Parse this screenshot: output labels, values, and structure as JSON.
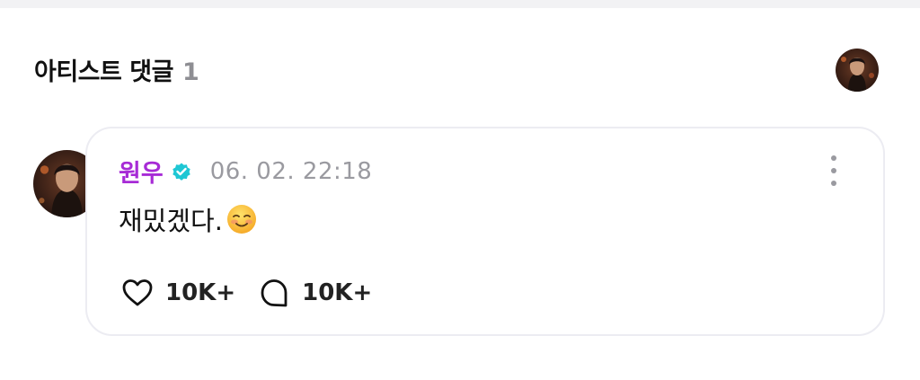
{
  "section": {
    "title": "아티스트 댓글",
    "count": "1"
  },
  "comment": {
    "author": "원우",
    "verified": true,
    "timestamp": "06. 02. 22:18",
    "text": "재밌겠다.",
    "emoji_icon": "smiling-face-icon",
    "likes": "10K+",
    "replies": "10K+"
  },
  "colors": {
    "author_name": "#a72bd6",
    "verified_badge": "#1fc7d4",
    "card_border": "#ececf2",
    "timestamp": "#9a9aa0"
  },
  "icons": {
    "verified": "verified-badge-icon",
    "more": "more-vertical-icon",
    "like": "heart-icon",
    "reply": "speech-bubble-icon"
  }
}
